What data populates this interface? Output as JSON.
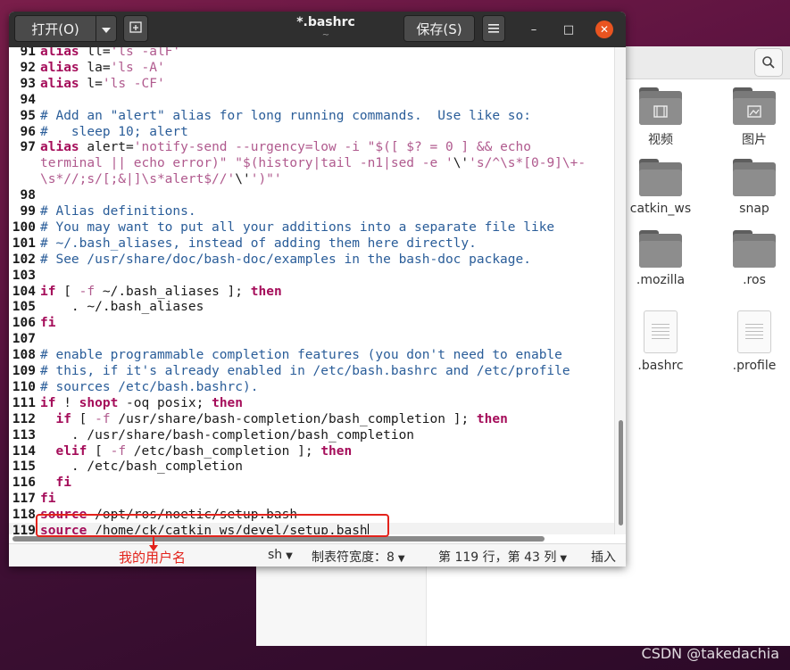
{
  "window": {
    "title": "*.bashrc",
    "subtitle": "~",
    "open_label": "打开(O)",
    "save_label": "保存(S)",
    "menu_icon": "hamburger-icon",
    "new_tab_icon": "new-document-icon",
    "minimize": "–",
    "maximize": "□",
    "close": "✕"
  },
  "code": {
    "lines": [
      {
        "n": "91",
        "segments": [
          {
            "t": "alias",
            "c": "kw"
          },
          {
            "t": " ll=",
            "c": "op"
          },
          {
            "t": "'ls -alF'",
            "c": "st"
          }
        ]
      },
      {
        "n": "92",
        "segments": [
          {
            "t": "alias",
            "c": "kw"
          },
          {
            "t": " la=",
            "c": "op"
          },
          {
            "t": "'ls -A'",
            "c": "st"
          }
        ]
      },
      {
        "n": "93",
        "segments": [
          {
            "t": "alias",
            "c": "kw"
          },
          {
            "t": " l=",
            "c": "op"
          },
          {
            "t": "'ls -CF'",
            "c": "st"
          }
        ]
      },
      {
        "n": "94",
        "segments": []
      },
      {
        "n": "95",
        "segments": [
          {
            "t": "# Add an \"alert\" alias for long running commands.  Use like so:",
            "c": "cm"
          }
        ]
      },
      {
        "n": "96",
        "segments": [
          {
            "t": "#   sleep 10; alert",
            "c": "cm"
          }
        ]
      },
      {
        "n": "97",
        "segments": [
          {
            "t": "alias",
            "c": "kw"
          },
          {
            "t": " alert=",
            "c": "op"
          },
          {
            "t": "'notify-send --urgency=low -i \"$([ $? = 0 ] && echo",
            "c": "st"
          }
        ]
      },
      {
        "n": "",
        "segments": [
          {
            "t": "terminal || echo error)\" \"$(history|tail -n1|sed -e '",
            "c": "st"
          },
          {
            "t": "\\'",
            "c": "op"
          },
          {
            "t": "'s/^\\s*[0-9]\\+-",
            "c": "st"
          }
        ]
      },
      {
        "n": "",
        "segments": [
          {
            "t": "\\s*//;s/[;&|]\\s*alert$//'",
            "c": "st"
          },
          {
            "t": "\\'",
            "c": "op"
          },
          {
            "t": "')\"'",
            "c": "st"
          }
        ]
      },
      {
        "n": "98",
        "segments": []
      },
      {
        "n": "99",
        "segments": [
          {
            "t": "# Alias definitions.",
            "c": "cm"
          }
        ]
      },
      {
        "n": "100",
        "segments": [
          {
            "t": "# You may want to put all your additions into a separate file like",
            "c": "cm"
          }
        ]
      },
      {
        "n": "101",
        "segments": [
          {
            "t": "# ~/.bash_aliases, instead of adding them here directly.",
            "c": "cm"
          }
        ]
      },
      {
        "n": "102",
        "segments": [
          {
            "t": "# See /usr/share/doc/bash-doc/examples in the bash-doc package.",
            "c": "cm"
          }
        ]
      },
      {
        "n": "103",
        "segments": []
      },
      {
        "n": "104",
        "segments": [
          {
            "t": "if",
            "c": "kw"
          },
          {
            "t": " [ ",
            "c": "op"
          },
          {
            "t": "-f",
            "c": "st"
          },
          {
            "t": " ~/.bash_aliases ]; ",
            "c": "op"
          },
          {
            "t": "then",
            "c": "kw"
          }
        ]
      },
      {
        "n": "105",
        "segments": [
          {
            "t": "    . ~/.bash_aliases",
            "c": "op"
          }
        ]
      },
      {
        "n": "106",
        "segments": [
          {
            "t": "fi",
            "c": "kw"
          }
        ]
      },
      {
        "n": "107",
        "segments": []
      },
      {
        "n": "108",
        "segments": [
          {
            "t": "# enable programmable completion features (you don't need to enable",
            "c": "cm"
          }
        ]
      },
      {
        "n": "109",
        "segments": [
          {
            "t": "# this, if it's already enabled in /etc/bash.bashrc and /etc/profile",
            "c": "cm"
          }
        ]
      },
      {
        "n": "110",
        "segments": [
          {
            "t": "# sources /etc/bash.bashrc).",
            "c": "cm"
          }
        ]
      },
      {
        "n": "111",
        "segments": [
          {
            "t": "if",
            "c": "kw"
          },
          {
            "t": " ! ",
            "c": "op"
          },
          {
            "t": "shopt",
            "c": "kw"
          },
          {
            "t": " -oq posix; ",
            "c": "op"
          },
          {
            "t": "then",
            "c": "kw"
          }
        ]
      },
      {
        "n": "112",
        "segments": [
          {
            "t": "  ",
            "c": "op"
          },
          {
            "t": "if",
            "c": "kw"
          },
          {
            "t": " [ ",
            "c": "op"
          },
          {
            "t": "-f",
            "c": "st"
          },
          {
            "t": " /usr/share/bash-completion/bash_completion ]; ",
            "c": "op"
          },
          {
            "t": "then",
            "c": "kw"
          }
        ]
      },
      {
        "n": "113",
        "segments": [
          {
            "t": "    . /usr/share/bash-completion/bash_completion",
            "c": "op"
          }
        ]
      },
      {
        "n": "114",
        "segments": [
          {
            "t": "  ",
            "c": "op"
          },
          {
            "t": "elif",
            "c": "kw"
          },
          {
            "t": " [ ",
            "c": "op"
          },
          {
            "t": "-f",
            "c": "st"
          },
          {
            "t": " /etc/bash_completion ]; ",
            "c": "op"
          },
          {
            "t": "then",
            "c": "kw"
          }
        ]
      },
      {
        "n": "115",
        "segments": [
          {
            "t": "    . /etc/bash_completion",
            "c": "op"
          }
        ]
      },
      {
        "n": "116",
        "segments": [
          {
            "t": "  ",
            "c": "op"
          },
          {
            "t": "fi",
            "c": "kw"
          }
        ]
      },
      {
        "n": "117",
        "segments": [
          {
            "t": "fi",
            "c": "kw"
          }
        ]
      },
      {
        "n": "118",
        "segments": [
          {
            "t": "source",
            "c": "kw"
          },
          {
            "t": " /opt/ros/noetic/setup.bash",
            "c": "op"
          }
        ]
      },
      {
        "n": "119",
        "segments": [
          {
            "t": "source",
            "c": "kw"
          },
          {
            "t": " /home/ck/catkin_ws/devel/setup.bash",
            "c": "op"
          }
        ],
        "current": true
      }
    ]
  },
  "statusbar": {
    "language": "sh",
    "tab_width": "制表符宽度：8",
    "position": "第 119 行，第 43 列",
    "mode": "插入"
  },
  "annotation": {
    "text": "我的用户名",
    "color": "#e3231c"
  },
  "file_manager": {
    "items": [
      {
        "label": "视频",
        "icon": "video-folder-icon"
      },
      {
        "label": "图片",
        "icon": "pictures-folder-icon"
      },
      {
        "label": "catkin_ws",
        "icon": "folder-icon"
      },
      {
        "label": "snap",
        "icon": "folder-icon"
      },
      {
        "label": ".mozilla",
        "icon": "folder-icon"
      },
      {
        "label": ".ros",
        "icon": "folder-icon"
      },
      {
        "label": ".bashrc",
        "icon": "text-file-icon"
      },
      {
        "label": ".profile",
        "icon": "text-file-icon"
      }
    ],
    "search_icon": "search-icon"
  },
  "watermark": "CSDN @takedachia",
  "colors": {
    "keyword": "#a50d5a",
    "comment": "#2a5d99",
    "string": "#b05a8e",
    "accent": "#e95420"
  }
}
